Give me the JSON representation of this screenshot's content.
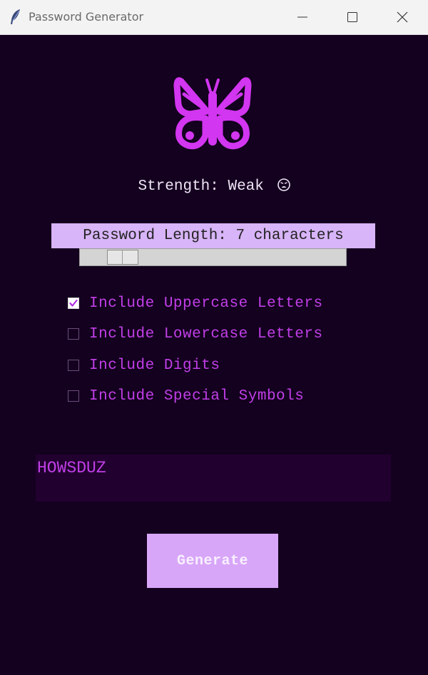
{
  "window": {
    "title": "Password Generator",
    "icons": {
      "app": "feather-icon",
      "minimize": "minimize-icon",
      "maximize": "maximize-icon",
      "close": "close-icon"
    }
  },
  "logo": {
    "icon": "butterfly-icon",
    "color": "#d236f0"
  },
  "strength": {
    "text": "Strength: Weak",
    "emoji": "weary-face-emoji"
  },
  "length": {
    "label": "Password Length:  7 characters",
    "value": 7,
    "slider_min": 4,
    "slider_max": 32
  },
  "options": [
    {
      "label": "Include Uppercase Letters",
      "checked": true
    },
    {
      "label": "Include Lowercase Letters",
      "checked": false
    },
    {
      "label": "Include Digits",
      "checked": false
    },
    {
      "label": "Include Special Symbols",
      "checked": false
    }
  ],
  "output": {
    "password": "HOWSDUZ"
  },
  "buttons": {
    "generate": "Generate"
  },
  "colors": {
    "background": "#14001f",
    "accent": "#c13fe8",
    "label_bg": "#d8b4f8",
    "button_bg": "#d8a6f8"
  }
}
